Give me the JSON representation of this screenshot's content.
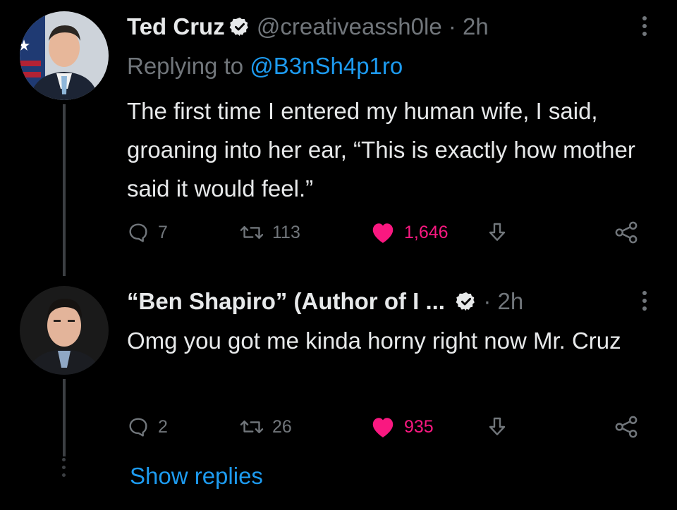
{
  "tweets": [
    {
      "name": "Ted Cruz",
      "handle": "@creativeassh0le",
      "separator": "·",
      "time": "2h",
      "replying_prefix": "Replying to ",
      "replying_to": "@B3nSh4p1ro",
      "text": "The first time I entered my human wife, I said, groaning into her ear, “This is exactly how mother said it would feel.”",
      "replies": "7",
      "retweets": "113",
      "likes": "1,646"
    },
    {
      "name": "“Ben Shapiro” (Author of I ...",
      "separator": "·",
      "time": "2h",
      "text": "Omg you got me kinda horny right now Mr. Cruz",
      "replies": "2",
      "retweets": "26",
      "likes": "935",
      "show_replies": "Show replies"
    }
  ],
  "colors": {
    "background": "#000000",
    "text": "#e7e9ea",
    "muted": "#71767b",
    "link": "#1d9bf0",
    "like": "#f91880",
    "thread_line": "#3c3f43"
  },
  "icons": {
    "reply": "speech-bubble-icon",
    "retweet": "retweet-arrows-icon",
    "like": "heart-icon",
    "download": "download-arrow-icon",
    "share": "share-nodes-icon",
    "more": "vertical-dots-icon",
    "verified": "verified-badge-icon"
  }
}
